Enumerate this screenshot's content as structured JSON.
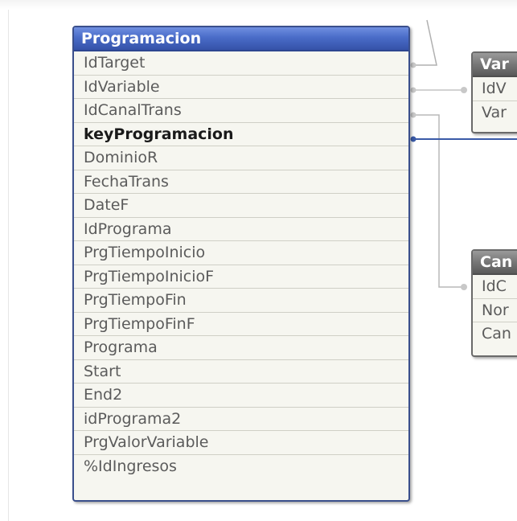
{
  "tables": {
    "programacion": {
      "title": "Programacion",
      "fields": [
        {
          "name": "IdTarget",
          "key": false
        },
        {
          "name": "IdVariable",
          "key": false
        },
        {
          "name": "IdCanalTrans",
          "key": false
        },
        {
          "name": "keyProgramacion",
          "key": true
        },
        {
          "name": "DominioR",
          "key": false
        },
        {
          "name": "FechaTrans",
          "key": false
        },
        {
          "name": "DateF",
          "key": false
        },
        {
          "name": "IdPrograma",
          "key": false
        },
        {
          "name": "PrgTiempoInicio",
          "key": false
        },
        {
          "name": "PrgTiempoInicioF",
          "key": false
        },
        {
          "name": "PrgTiempoFin",
          "key": false
        },
        {
          "name": "PrgTiempoFinF",
          "key": false
        },
        {
          "name": "Programa",
          "key": false
        },
        {
          "name": "Start",
          "key": false
        },
        {
          "name": "End2",
          "key": false
        },
        {
          "name": "idPrograma2",
          "key": false
        },
        {
          "name": "PrgValorVariable",
          "key": false
        },
        {
          "name": "%IdIngresos",
          "key": false
        }
      ]
    },
    "variable": {
      "title": "Var",
      "fields": [
        {
          "name": "IdV",
          "key": false
        },
        {
          "name": "Var",
          "key": false
        }
      ]
    },
    "canal": {
      "title": "Can",
      "fields": [
        {
          "name": "IdC",
          "key": false
        },
        {
          "name": "Nor",
          "key": false
        },
        {
          "name": "Can",
          "key": false
        }
      ]
    }
  },
  "colors": {
    "link_gray": "#b0b0b0",
    "link_key": "#3a5aa8",
    "header_blue": "#4a6cc8",
    "header_gray": "#777777"
  }
}
